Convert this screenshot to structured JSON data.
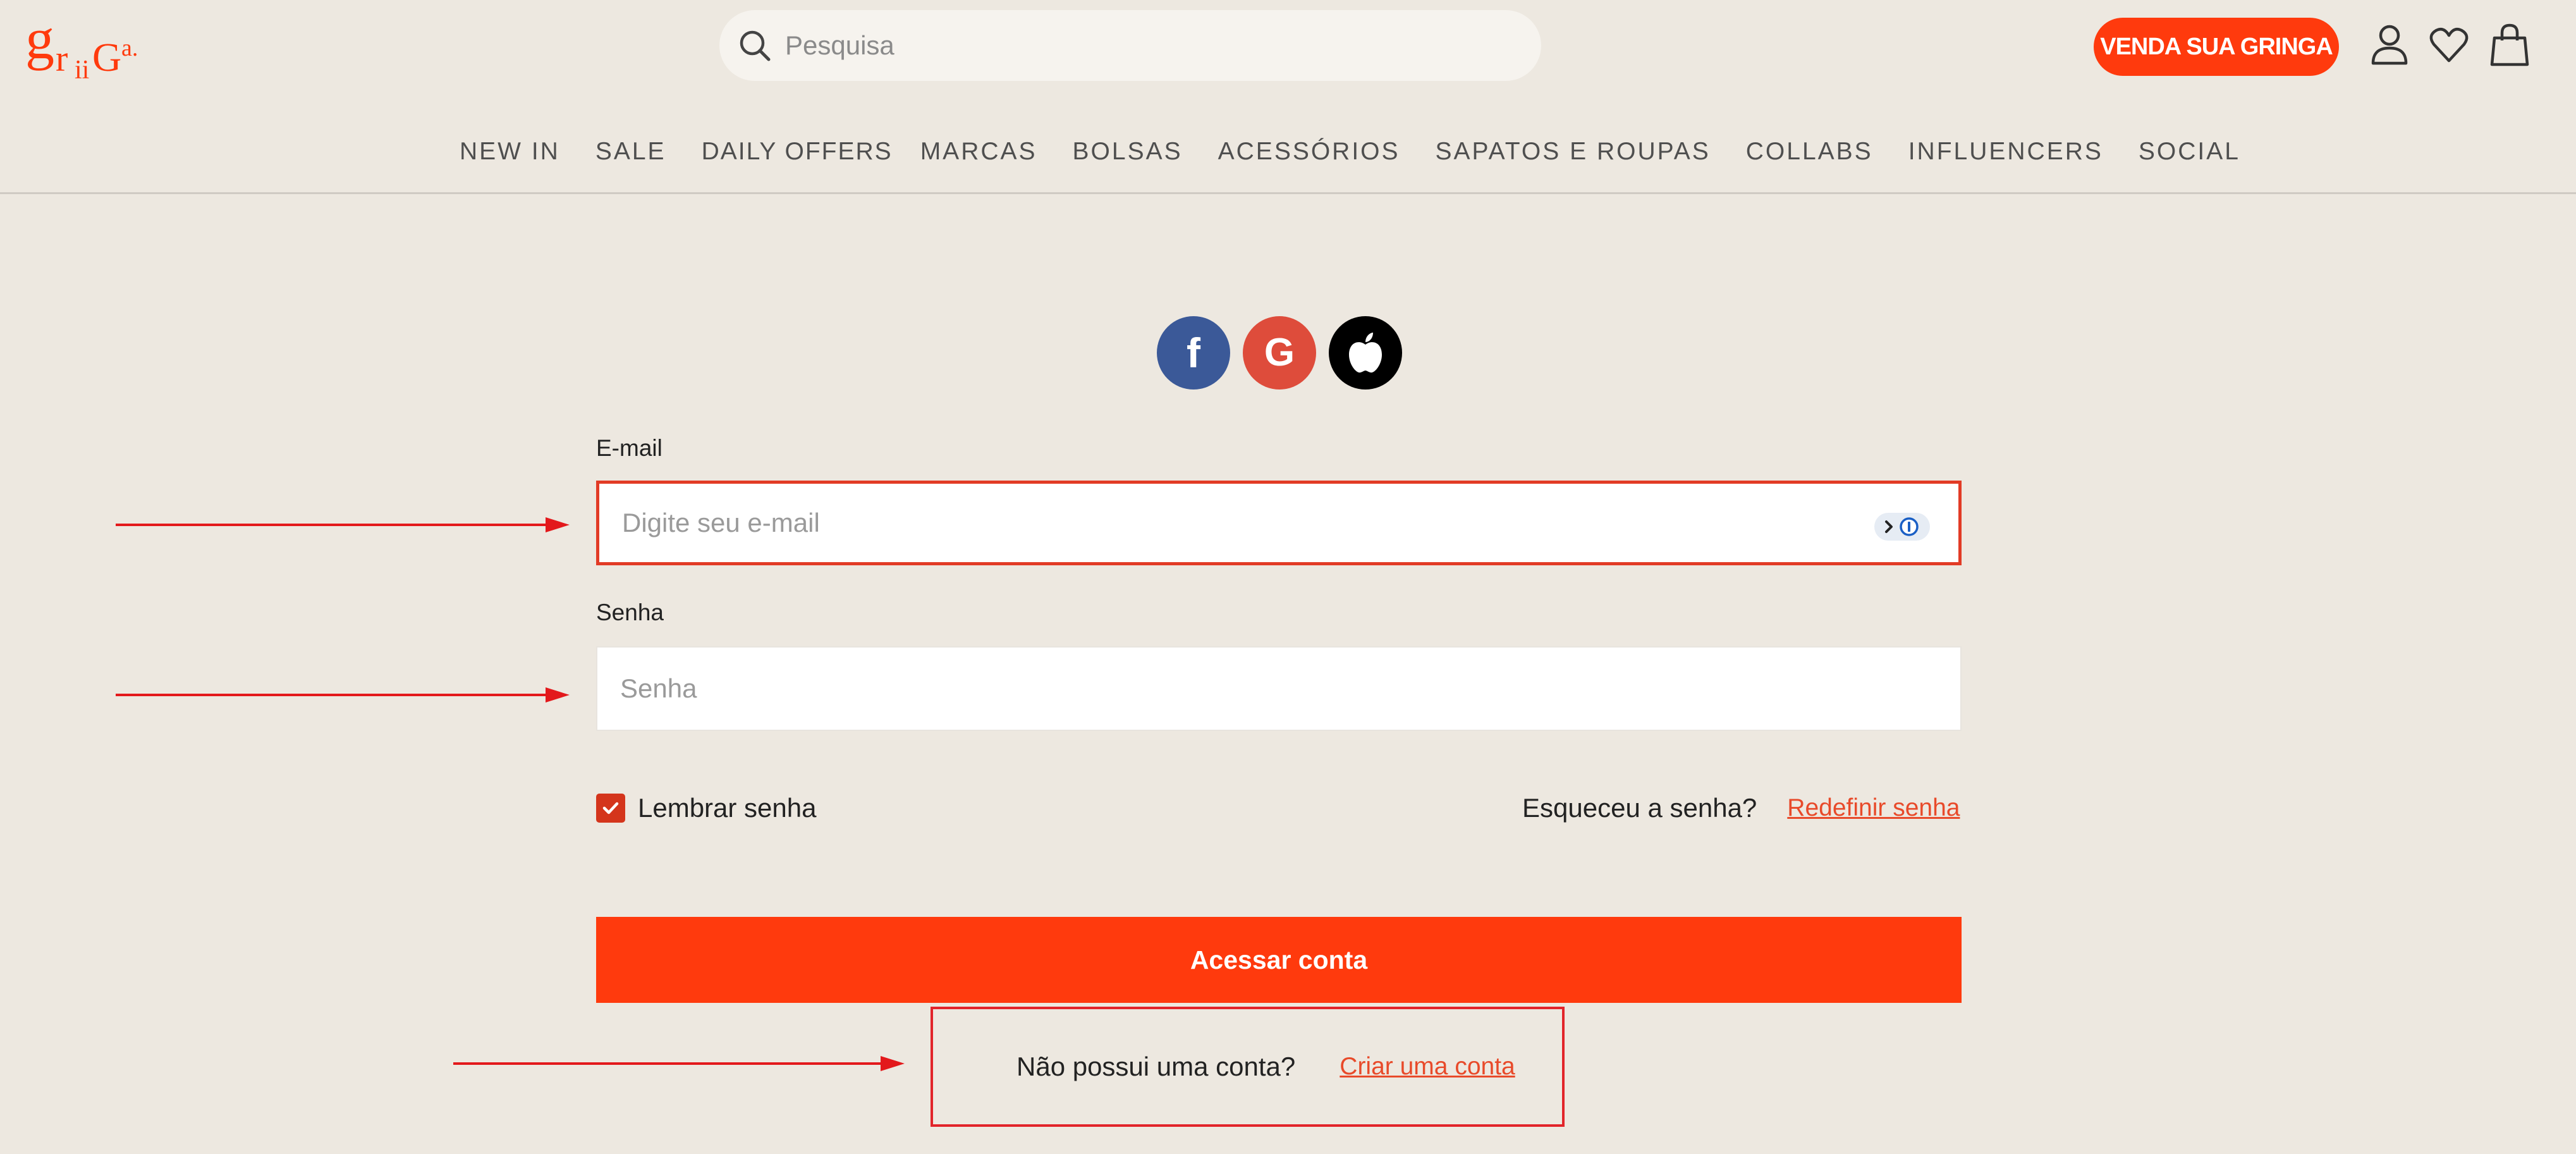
{
  "header": {
    "logo_text": "griiGa.",
    "search_placeholder": "Pesquisa",
    "sell_button": "VENDA SUA GRINGA",
    "icons": [
      "user-icon",
      "heart-icon",
      "bag-icon"
    ],
    "accent_color": "#ff3a0d"
  },
  "nav": {
    "items": [
      "NEW IN",
      "SALE",
      "DAILY OFFERS",
      "MARCAS",
      "BOLSAS",
      "ACESSÓRIOS",
      "SAPATOS E ROUPAS",
      "COLLABS",
      "INFLUENCERS",
      "SOCIAL"
    ]
  },
  "social": {
    "facebook_letter": "f",
    "google_letter": "G",
    "icons": [
      "facebook-icon",
      "google-icon",
      "apple-icon"
    ],
    "colors": {
      "facebook": "#3b5998",
      "google": "#de4c3b",
      "apple": "#000000"
    }
  },
  "form": {
    "email_label": "E-mail",
    "email_placeholder": "Digite seu e-mail",
    "password_label": "Senha",
    "password_placeholder": "Senha",
    "remember_label": "Lembrar senha",
    "remember_checked": true,
    "forgot_text": "Esqueceu a senha?",
    "reset_link": "Redefinir senha",
    "submit_label": "Acessar conta",
    "no_account_text": "Não possui uma conta?",
    "create_link": "Criar uma conta"
  }
}
